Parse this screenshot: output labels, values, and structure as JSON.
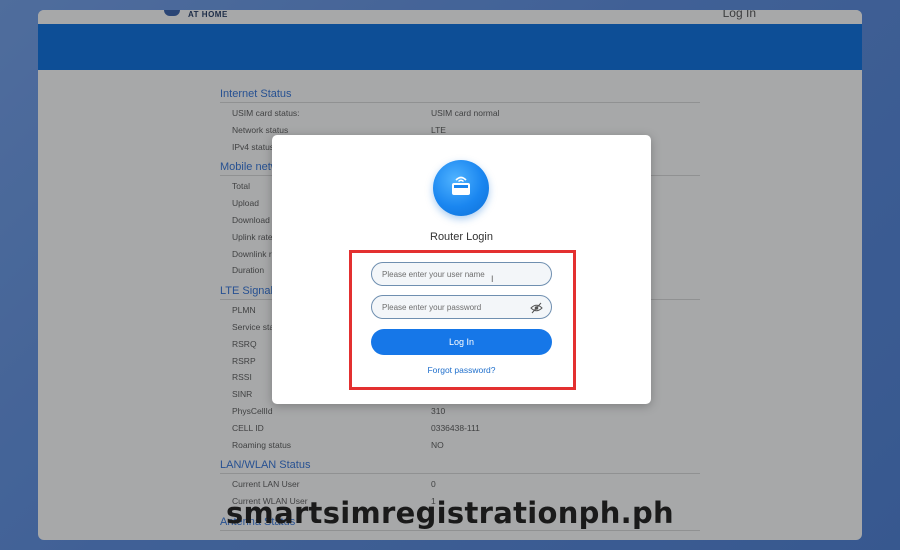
{
  "header": {
    "brand_text": "AT HOME",
    "login_link": "Log In"
  },
  "sections": [
    {
      "title": "Internet Status",
      "rows": [
        {
          "label": "USIM card status:",
          "value": "USIM card normal"
        },
        {
          "label": "Network status",
          "value": "LTE"
        },
        {
          "label": "IPv4 status",
          "value": ""
        }
      ]
    },
    {
      "title": "Mobile network",
      "rows": [
        {
          "label": "Total",
          "value": ""
        },
        {
          "label": "Upload",
          "value": ""
        },
        {
          "label": "Download",
          "value": ""
        },
        {
          "label": "Uplink rate",
          "value": ""
        },
        {
          "label": "Downlink rate",
          "value": ""
        },
        {
          "label": "Duration",
          "value": ""
        }
      ]
    },
    {
      "title": "LTE Signal",
      "rows": [
        {
          "label": "PLMN",
          "value": ""
        },
        {
          "label": "Service status",
          "value": ""
        },
        {
          "label": "RSRQ",
          "value": ""
        },
        {
          "label": "RSRP",
          "value": ""
        },
        {
          "label": "RSSI",
          "value": ""
        },
        {
          "label": "SINR",
          "value": ""
        },
        {
          "label": "PhysCellId",
          "value": "310"
        },
        {
          "label": "CELL ID",
          "value": "0336438-111"
        },
        {
          "label": "Roaming status",
          "value": "NO"
        }
      ]
    },
    {
      "title": "LAN/WLAN Status",
      "rows": [
        {
          "label": "Current LAN User",
          "value": "0"
        },
        {
          "label": "Current WLAN User",
          "value": "1"
        }
      ]
    },
    {
      "title": "Antenna Status",
      "rows": []
    }
  ],
  "modal": {
    "title": "Router Login",
    "username_placeholder": "Please enter your user name",
    "password_placeholder": "Please enter your password",
    "login_button": "Log In",
    "forgot_link": "Forgot password?",
    "icon": "router-icon",
    "highlight_color": "#e33030",
    "accent_color": "#1677e8"
  },
  "watermark": "smartsimregistrationph.ph"
}
